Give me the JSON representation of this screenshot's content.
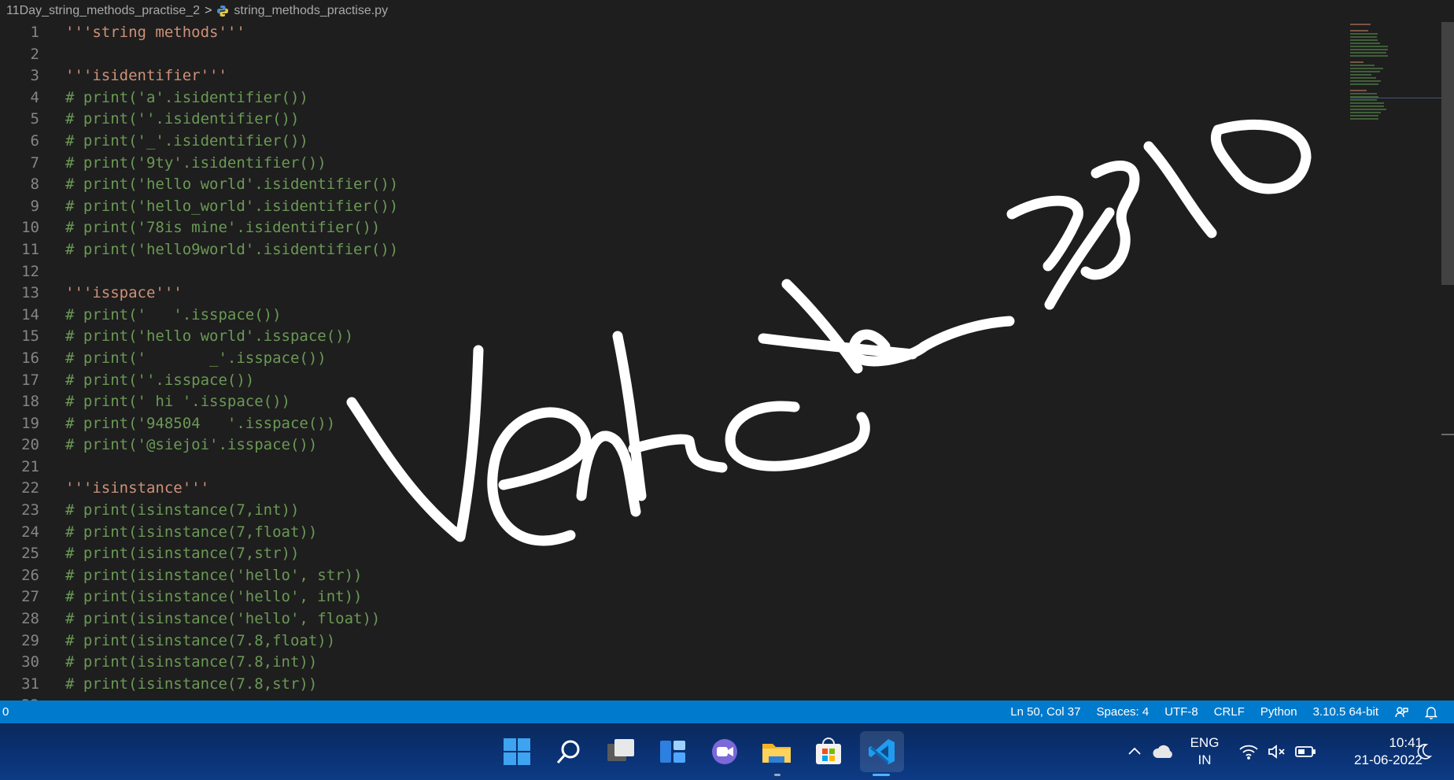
{
  "breadcrumb": {
    "folder": "11Day_string_methods_practise_2",
    "separator": ">",
    "file": "string_methods_practise.py"
  },
  "code_lines": [
    {
      "n": "1",
      "text": "'''string methods'''",
      "kind": "doc"
    },
    {
      "n": "2",
      "text": "",
      "kind": "plain"
    },
    {
      "n": "3",
      "text": "'''isidentifier'''",
      "kind": "doc"
    },
    {
      "n": "4",
      "text": "# print('a'.isidentifier())",
      "kind": "com"
    },
    {
      "n": "5",
      "text": "# print(''.isidentifier())",
      "kind": "com"
    },
    {
      "n": "6",
      "text": "# print('_'.isidentifier())",
      "kind": "com"
    },
    {
      "n": "7",
      "text": "# print('9ty'.isidentifier())",
      "kind": "com"
    },
    {
      "n": "8",
      "text": "# print('hello world'.isidentifier())",
      "kind": "com"
    },
    {
      "n": "9",
      "text": "# print('hello_world'.isidentifier())",
      "kind": "com"
    },
    {
      "n": "10",
      "text": "# print('78is mine'.isidentifier())",
      "kind": "com"
    },
    {
      "n": "11",
      "text": "# print('hello9world'.isidentifier())",
      "kind": "com"
    },
    {
      "n": "12",
      "text": "",
      "kind": "plain"
    },
    {
      "n": "13",
      "text": "'''isspace'''",
      "kind": "doc"
    },
    {
      "n": "14",
      "text": "# print('   '.isspace())",
      "kind": "com"
    },
    {
      "n": "15",
      "text": "# print('hello world'.isspace())",
      "kind": "com"
    },
    {
      "n": "16",
      "text": "# print('       _'.isspace())",
      "kind": "com"
    },
    {
      "n": "17",
      "text": "# print(''.isspace())",
      "kind": "com"
    },
    {
      "n": "18",
      "text": "# print(' hi '.isspace())",
      "kind": "com"
    },
    {
      "n": "19",
      "text": "# print('948504   '.isspace())",
      "kind": "com"
    },
    {
      "n": "20",
      "text": "# print('@siejoi'.isspace())",
      "kind": "com"
    },
    {
      "n": "21",
      "text": "",
      "kind": "plain"
    },
    {
      "n": "22",
      "text": "'''isinstance'''",
      "kind": "doc"
    },
    {
      "n": "23",
      "text": "# print(isinstance(7,int))",
      "kind": "com"
    },
    {
      "n": "24",
      "text": "# print(isinstance(7,float))",
      "kind": "com"
    },
    {
      "n": "25",
      "text": "# print(isinstance(7,str))",
      "kind": "com"
    },
    {
      "n": "26",
      "text": "# print(isinstance('hello', str))",
      "kind": "com"
    },
    {
      "n": "27",
      "text": "# print(isinstance('hello', int))",
      "kind": "com"
    },
    {
      "n": "28",
      "text": "# print(isinstance('hello', float))",
      "kind": "com"
    },
    {
      "n": "29",
      "text": "# print(isinstance(7.8,float))",
      "kind": "com"
    },
    {
      "n": "30",
      "text": "# print(isinstance(7.8,int))",
      "kind": "com"
    },
    {
      "n": "31",
      "text": "# print(isinstance(7.8,str))",
      "kind": "com"
    },
    {
      "n": "32",
      "text": "",
      "kind": "plain"
    }
  ],
  "overlay_signature": "Venkata2310",
  "statusbar": {
    "left_count": "0",
    "position": "Ln 50, Col 37",
    "spaces": "Spaces: 4",
    "encoding": "UTF-8",
    "eol": "CRLF",
    "language": "Python",
    "interpreter": "3.10.5 64-bit"
  },
  "taskbar": {
    "language_line1": "ENG",
    "language_line2": "IN",
    "time": "10:41",
    "date": "21-06-2022"
  },
  "colors": {
    "editor_bg": "#1e1e1e",
    "statusbar_bg": "#007acc",
    "docstring": "#ce9178",
    "comment": "#6a9955",
    "line_number": "#858585"
  }
}
